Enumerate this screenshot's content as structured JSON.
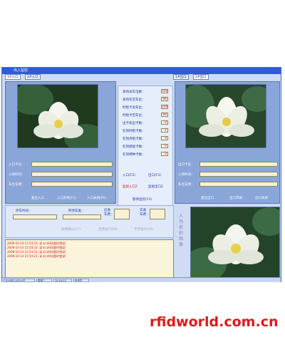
{
  "window": {
    "title": "出入监控"
  },
  "entry": {
    "tabs": [
      "1#入口",
      "2#入口"
    ],
    "fields": [
      {
        "label": "入口卡号："
      },
      {
        "label": "入场时间："
      },
      {
        "label": "车主车牌："
      }
    ],
    "buttons": [
      "复位入口",
      "入口开闸(F1)",
      "入口关闸(F6)"
    ]
  },
  "exit": {
    "tabs": [
      "1#出口",
      "2#出口"
    ],
    "fields": [
      {
        "label": "出口卡号："
      },
      {
        "label": "入场时间："
      },
      {
        "label": "车主车牌："
      }
    ],
    "buttons": [
      "复位出口",
      "出口开闸",
      "出口关闸"
    ]
  },
  "counters": [
    {
      "label": "某场总车位数：",
      "value": "100"
    },
    {
      "label": "某场车空车位：",
      "value": "96"
    },
    {
      "label": "时租卡总车位：",
      "value": "100"
    },
    {
      "label": "时租卡空车位：",
      "value": "99"
    },
    {
      "label": "出卡机出卡数：",
      "value": "0"
    },
    {
      "label": "在场时租卡数：",
      "value": "1"
    },
    {
      "label": "在场月租卡数：",
      "value": "4"
    },
    {
      "label": "在场储值卡数：",
      "value": "0"
    },
    {
      "label": "在场特种卡数：",
      "value": "0"
    }
  ],
  "center_buttons": {
    "entry": "入口(F2)",
    "exit": "出口(F3)",
    "monitor_entry": "监视入口2",
    "monitor_exit": "监视出口2",
    "stop": "暂停监控(F4)"
  },
  "lower": {
    "parking_time_label": "停车时间：",
    "type_label": "所停车类：",
    "due_label": "应收\n车费：",
    "paid_label": "实收\n车费：",
    "btn_confirm": "收费确认(F7)",
    "btn_prev": "无费放行(F8)",
    "btn_next": "不予放行(F9)"
  },
  "log": [
    "2009-10-14 15:54:23: 读卡口时间超时错误!",
    "2009-10-14 15:54:23: 读卡口时间超时错误!",
    "2009-10-14 15:54:23: 读卡口时间超时错误!",
    "2009-10-14 15:54:23: 读卡口时间超时错误!"
  ],
  "status": [
    "2009年10月14日",
    "星期三",
    "15:54:23",
    "系统员"
  ],
  "side_caption": "入场抓拍图像",
  "watermark": "rfidworld.com.cn"
}
